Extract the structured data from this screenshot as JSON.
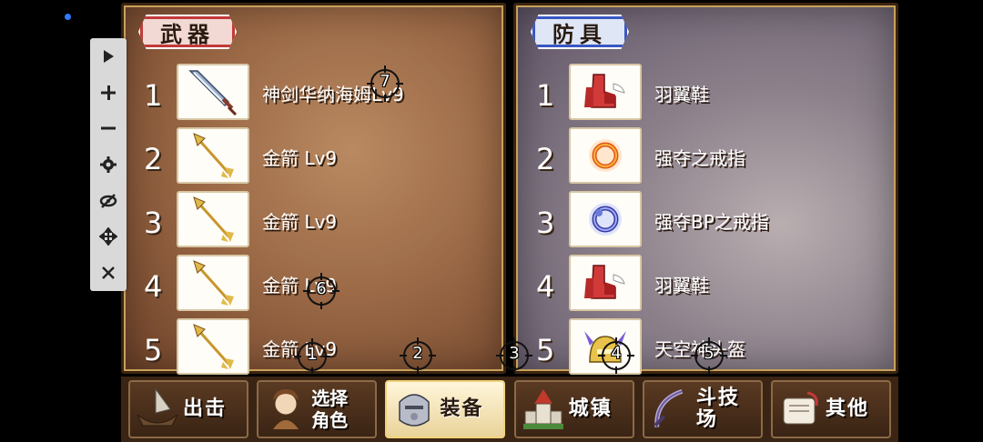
{
  "weapons": {
    "tag": "武器",
    "items": [
      {
        "num": "1",
        "name": "神剑华纳海姆Lv9",
        "icon": "sword-icon"
      },
      {
        "num": "2",
        "name": "金箭 Lv9",
        "icon": "arrow-icon"
      },
      {
        "num": "3",
        "name": "金箭 Lv9",
        "icon": "arrow-icon"
      },
      {
        "num": "4",
        "name": "金箭 Lv9",
        "icon": "arrow-icon"
      },
      {
        "num": "5",
        "name": "金箭 Lv9",
        "icon": "arrow-icon"
      }
    ]
  },
  "armor": {
    "tag": "防具",
    "items": [
      {
        "num": "1",
        "name": "羽翼鞋",
        "icon": "winged-boots-icon"
      },
      {
        "num": "2",
        "name": "强夺之戒指",
        "icon": "ring-icon"
      },
      {
        "num": "3",
        "name": "强夺BP之戒指",
        "icon": "bp-ring-icon"
      },
      {
        "num": "4",
        "name": "羽翼鞋",
        "icon": "winged-boots-icon"
      },
      {
        "num": "5",
        "name": "天空神头盔",
        "icon": "helmet-icon"
      }
    ]
  },
  "nav": {
    "sortie": "出击",
    "select_1": "选择",
    "select_2": "角色",
    "equip": "装备",
    "town": "城镇",
    "arena": "斗技场",
    "other": "其他"
  },
  "targets": [
    "1",
    "2",
    "3",
    "4",
    "5",
    "6",
    "7"
  ],
  "colors": {
    "accent_red": "#c23a3a",
    "accent_blue": "#3a58c2",
    "indicator": "#2f7bff"
  }
}
